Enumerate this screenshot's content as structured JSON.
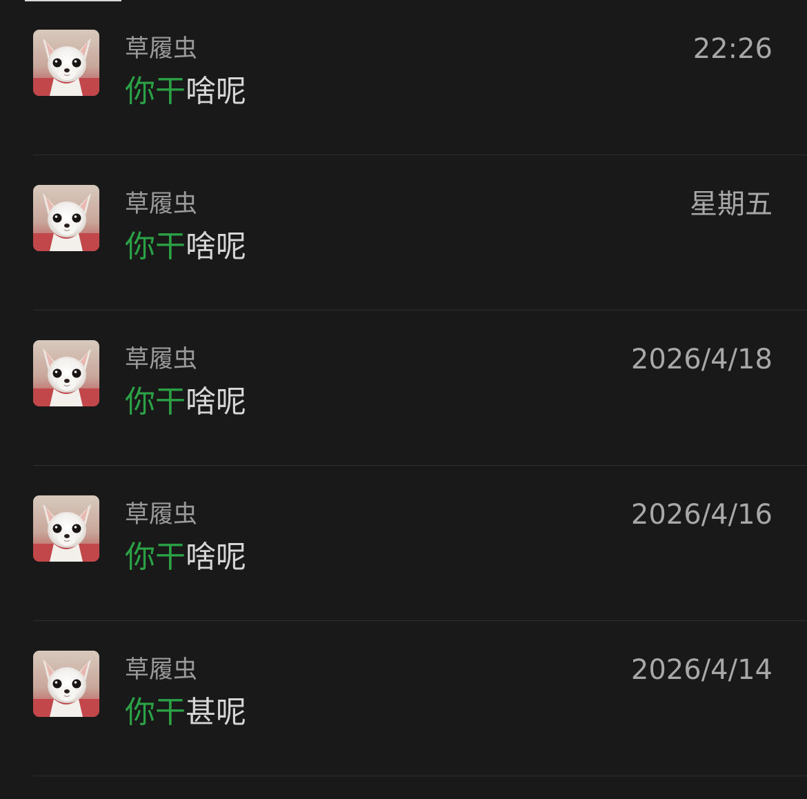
{
  "colors": {
    "background": "#191919",
    "sender_text": "#9a9a9a",
    "time_text": "#a8a8a8",
    "highlight_green": "#2ba245",
    "message_text": "#d6d6d6",
    "divider": "#2e2e2e"
  },
  "messages": [
    {
      "sender": "草履虫",
      "time": "22:26",
      "highlight": "你干",
      "rest": "啥呢",
      "avatar_icon": "chihuahua-avatar-icon"
    },
    {
      "sender": "草履虫",
      "time": "星期五",
      "highlight": "你干",
      "rest": "啥呢",
      "avatar_icon": "chihuahua-avatar-icon"
    },
    {
      "sender": "草履虫",
      "time": "2026/4/18",
      "highlight": "你干",
      "rest": "啥呢",
      "avatar_icon": "chihuahua-avatar-icon"
    },
    {
      "sender": "草履虫",
      "time": "2026/4/16",
      "highlight": "你干",
      "rest": "啥呢",
      "avatar_icon": "chihuahua-avatar-icon"
    },
    {
      "sender": "草履虫",
      "time": "2026/4/14",
      "highlight": "你干",
      "rest": "甚呢",
      "avatar_icon": "chihuahua-avatar-icon"
    }
  ]
}
